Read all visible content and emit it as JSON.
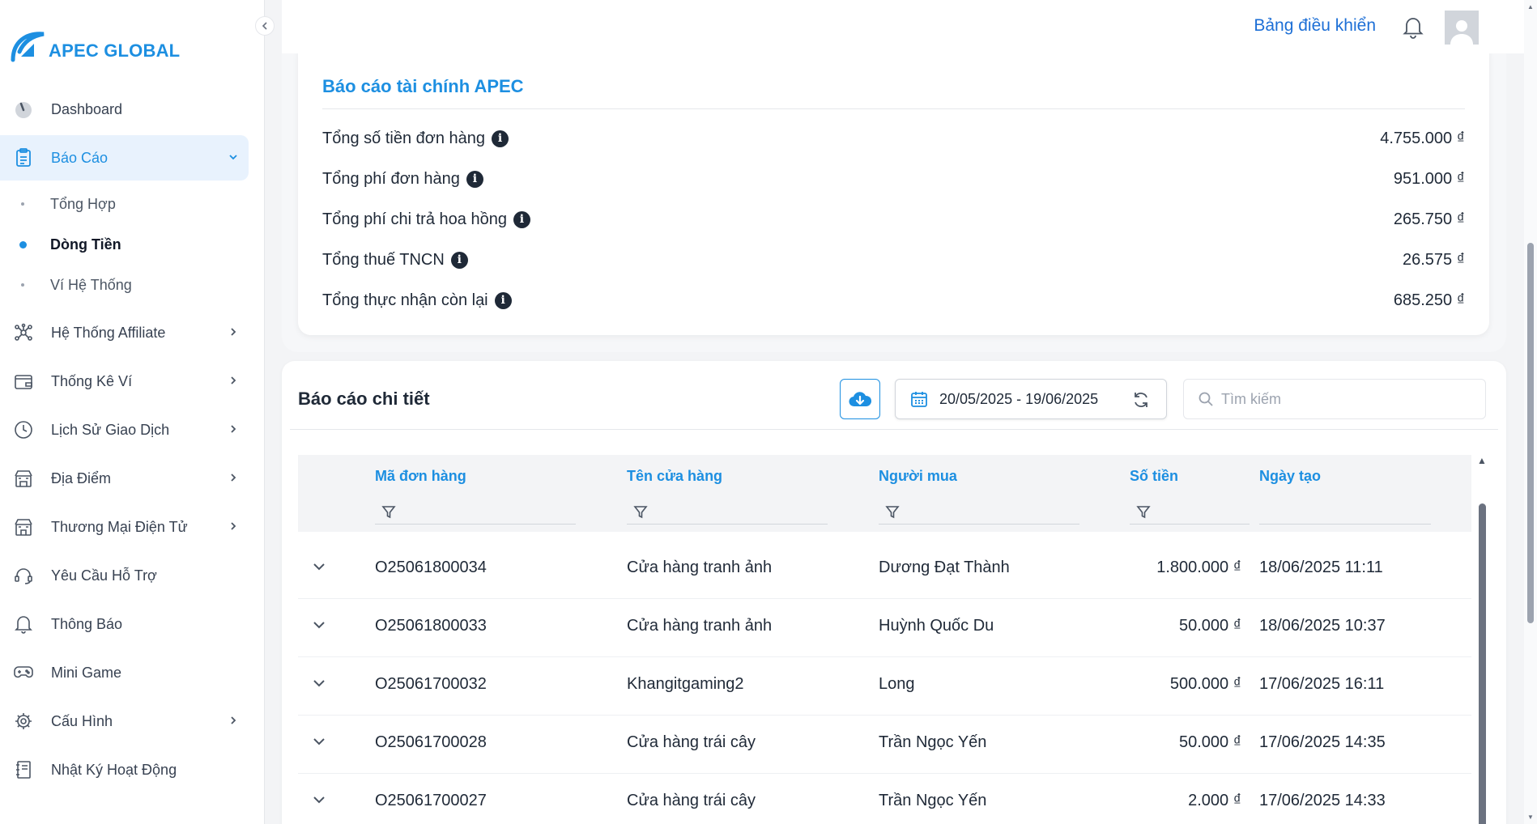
{
  "brand": {
    "name": "APEC GLOBAL",
    "color": "#1d8fe1"
  },
  "sidebar": {
    "collapse_icon": "chevron-left-icon",
    "items": [
      {
        "label": "Dashboard",
        "icon": "gauge-icon"
      },
      {
        "label": "Báo Cáo",
        "icon": "clipboard-icon",
        "expanded": true,
        "children": [
          {
            "label": "Tổng Hợp"
          },
          {
            "label": "Dòng Tiền",
            "active": true
          },
          {
            "label": "Ví Hệ Thống"
          }
        ]
      },
      {
        "label": "Hệ Thống Affiliate",
        "icon": "network-icon"
      },
      {
        "label": "Thống Kê Ví",
        "icon": "wallet-icon"
      },
      {
        "label": "Lịch Sử Giao Dịch",
        "icon": "clock-icon"
      },
      {
        "label": "Địa Điểm",
        "icon": "store-icon"
      },
      {
        "label": "Thương Mại Điện Tử",
        "icon": "shop-icon"
      },
      {
        "label": "Yêu Cầu Hỗ Trợ",
        "icon": "headset-icon"
      },
      {
        "label": "Thông Báo",
        "icon": "bell-icon"
      },
      {
        "label": "Mini Game",
        "icon": "gamepad-icon"
      },
      {
        "label": "Cấu Hình",
        "icon": "gear-icon"
      },
      {
        "label": "Nhật Ký Hoạt Động",
        "icon": "notebook-icon"
      }
    ]
  },
  "header": {
    "title": "Bảng điều khiển"
  },
  "summary": {
    "title": "Báo cáo tài chính APEC",
    "rows": [
      {
        "label": "Tổng số tiền đơn hàng",
        "value": "4.755.000 ₫"
      },
      {
        "label": "Tổng phí đơn hàng",
        "value": "951.000 ₫"
      },
      {
        "label": "Tổng phí chi trả hoa hồng",
        "value": "265.750 ₫"
      },
      {
        "label": "Tổng thuế TNCN",
        "value": "26.575 ₫"
      },
      {
        "label": "Tổng thực nhận còn lại",
        "value": "685.250 ₫"
      }
    ]
  },
  "detail": {
    "title": "Báo cáo chi tiết",
    "date_range": "20/05/2025 - 19/06/2025",
    "search_placeholder": "Tìm kiếm",
    "columns": [
      "Mã đơn hàng",
      "Tên cửa hàng",
      "Người mua",
      "Số tiền",
      "Ngày tạo"
    ],
    "rows": [
      [
        "O25061800034",
        "Cửa hàng tranh ảnh",
        "Dương Đạt Thành",
        "1.800.000 ₫",
        "18/06/2025 11:11"
      ],
      [
        "O25061800033",
        "Cửa hàng tranh ảnh",
        "Huỳnh Quốc Du",
        "50.000 ₫",
        "18/06/2025 10:37"
      ],
      [
        "O25061700032",
        "Khangitgaming2",
        "Long",
        "500.000 ₫",
        "17/06/2025 16:11"
      ],
      [
        "O25061700028",
        "Cửa hàng trái cây",
        "Trần Ngọc Yến",
        "50.000 ₫",
        "17/06/2025 14:35"
      ],
      [
        "O25061700027",
        "Cửa hàng trái cây",
        "Trần Ngọc Yến",
        "2.000 ₫",
        "17/06/2025 14:33"
      ]
    ]
  }
}
